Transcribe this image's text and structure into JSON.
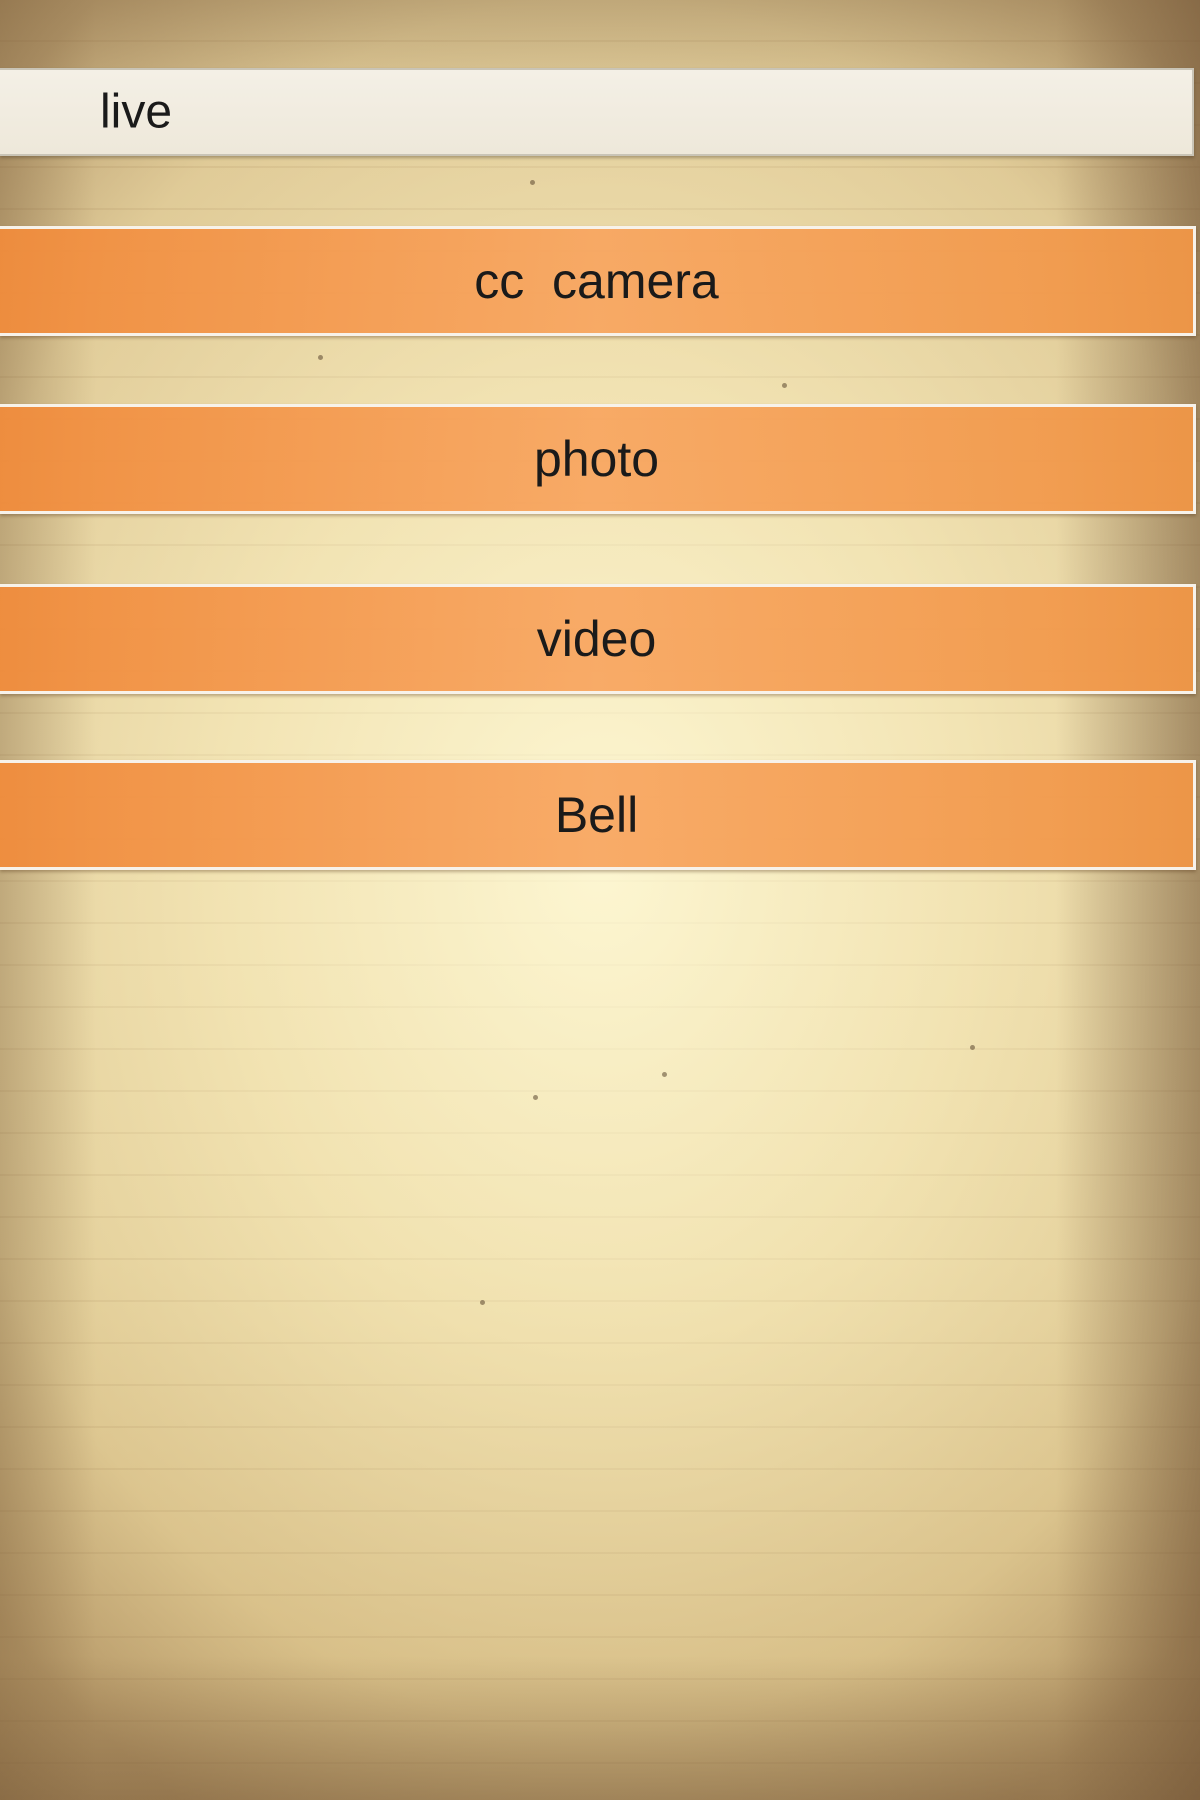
{
  "live_bar": {
    "label": "live"
  },
  "menu": {
    "items": [
      {
        "label": "cc  camera"
      },
      {
        "label": "photo"
      },
      {
        "label": "video"
      },
      {
        "label": "Bell"
      }
    ]
  },
  "colors": {
    "button_orange": "#F39A52",
    "button_border": "#F7F2EA",
    "live_bar_bg": "#F2EEE3",
    "paper_background": "#EDDDAE"
  }
}
